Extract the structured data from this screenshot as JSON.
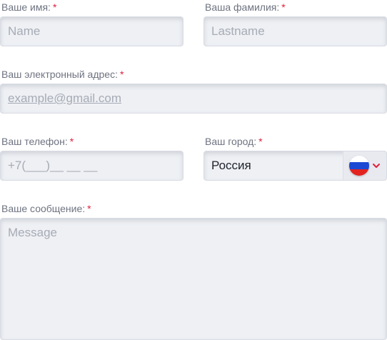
{
  "form": {
    "first_name": {
      "label": "Ваше имя:",
      "required_mark": "*",
      "placeholder": "Name"
    },
    "last_name": {
      "label": "Ваша фамилия:",
      "required_mark": "*",
      "placeholder": "Lastname"
    },
    "email": {
      "label": "Ваш электронный адрес:",
      "required_mark": "*",
      "placeholder": "example@gmail.com"
    },
    "phone": {
      "label": "Ваш телефон:",
      "required_mark": "*",
      "mask": "+7(___)__ __ __"
    },
    "city": {
      "label": "Ваш город:",
      "required_mark": "*",
      "selected_value": "Россия",
      "flag_icon": "russia-flag-icon"
    },
    "message": {
      "label": "Ваше сообщение:",
      "required_mark": "*",
      "placeholder": "Message"
    }
  },
  "colors": {
    "required": "#e0203c",
    "field_background": "#eef0f4",
    "label_text": "#6e7380",
    "placeholder_text": "#a7abb5"
  }
}
